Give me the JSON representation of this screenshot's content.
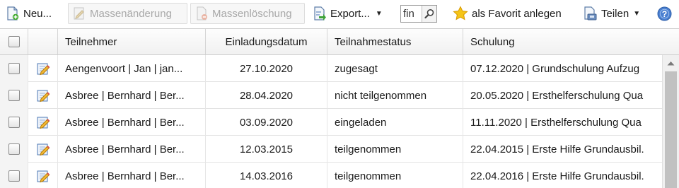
{
  "toolbar": {
    "new_label": "Neu...",
    "mass_edit_label": "Massenänderung",
    "mass_delete_label": "Massenlöschung",
    "export_label": "Export...",
    "search_value": "fin",
    "favorite_label": "als Favorit anlegen",
    "share_label": "Teilen"
  },
  "columns": {
    "participant": "Teilnehmer",
    "invite_date": "Einladungsdatum",
    "status": "Teilnahmestatus",
    "training": "Schulung"
  },
  "rows": [
    {
      "participant": "Aengenvoort | Jan | jan...",
      "invite_date": "27.10.2020",
      "status": "zugesagt",
      "training": "07.12.2020 | Grundschulung Aufzug"
    },
    {
      "participant": "Asbree | Bernhard | Ber...",
      "invite_date": "28.04.2020",
      "status": "nicht teilgenommen",
      "training": "20.05.2020 | Ersthelferschulung Qua"
    },
    {
      "participant": "Asbree | Bernhard | Ber...",
      "invite_date": "03.09.2020",
      "status": "eingeladen",
      "training": "11.11.2020 | Ersthelferschulung Qua"
    },
    {
      "participant": "Asbree | Bernhard | Ber...",
      "invite_date": "12.03.2015",
      "status": "teilgenommen",
      "training": "22.04.2015 | Erste Hilfe Grundausbil."
    },
    {
      "participant": "Asbree | Bernhard | Ber...",
      "invite_date": "14.03.2016",
      "status": "teilgenommen",
      "training": "22.04.2016 | Erste Hilfe Grundausbil."
    }
  ],
  "colors": {
    "accent_blue": "#3b73c8",
    "star_yellow": "#f2b705",
    "header_bg": "#f1f1f1"
  },
  "icons": [
    "new-document-icon",
    "mass-edit-icon",
    "mass-delete-icon",
    "export-icon",
    "search-icon",
    "favorite-star-icon",
    "share-icon",
    "help-icon",
    "edit-icon",
    "chevron-down-icon",
    "scroll-up-icon"
  ]
}
